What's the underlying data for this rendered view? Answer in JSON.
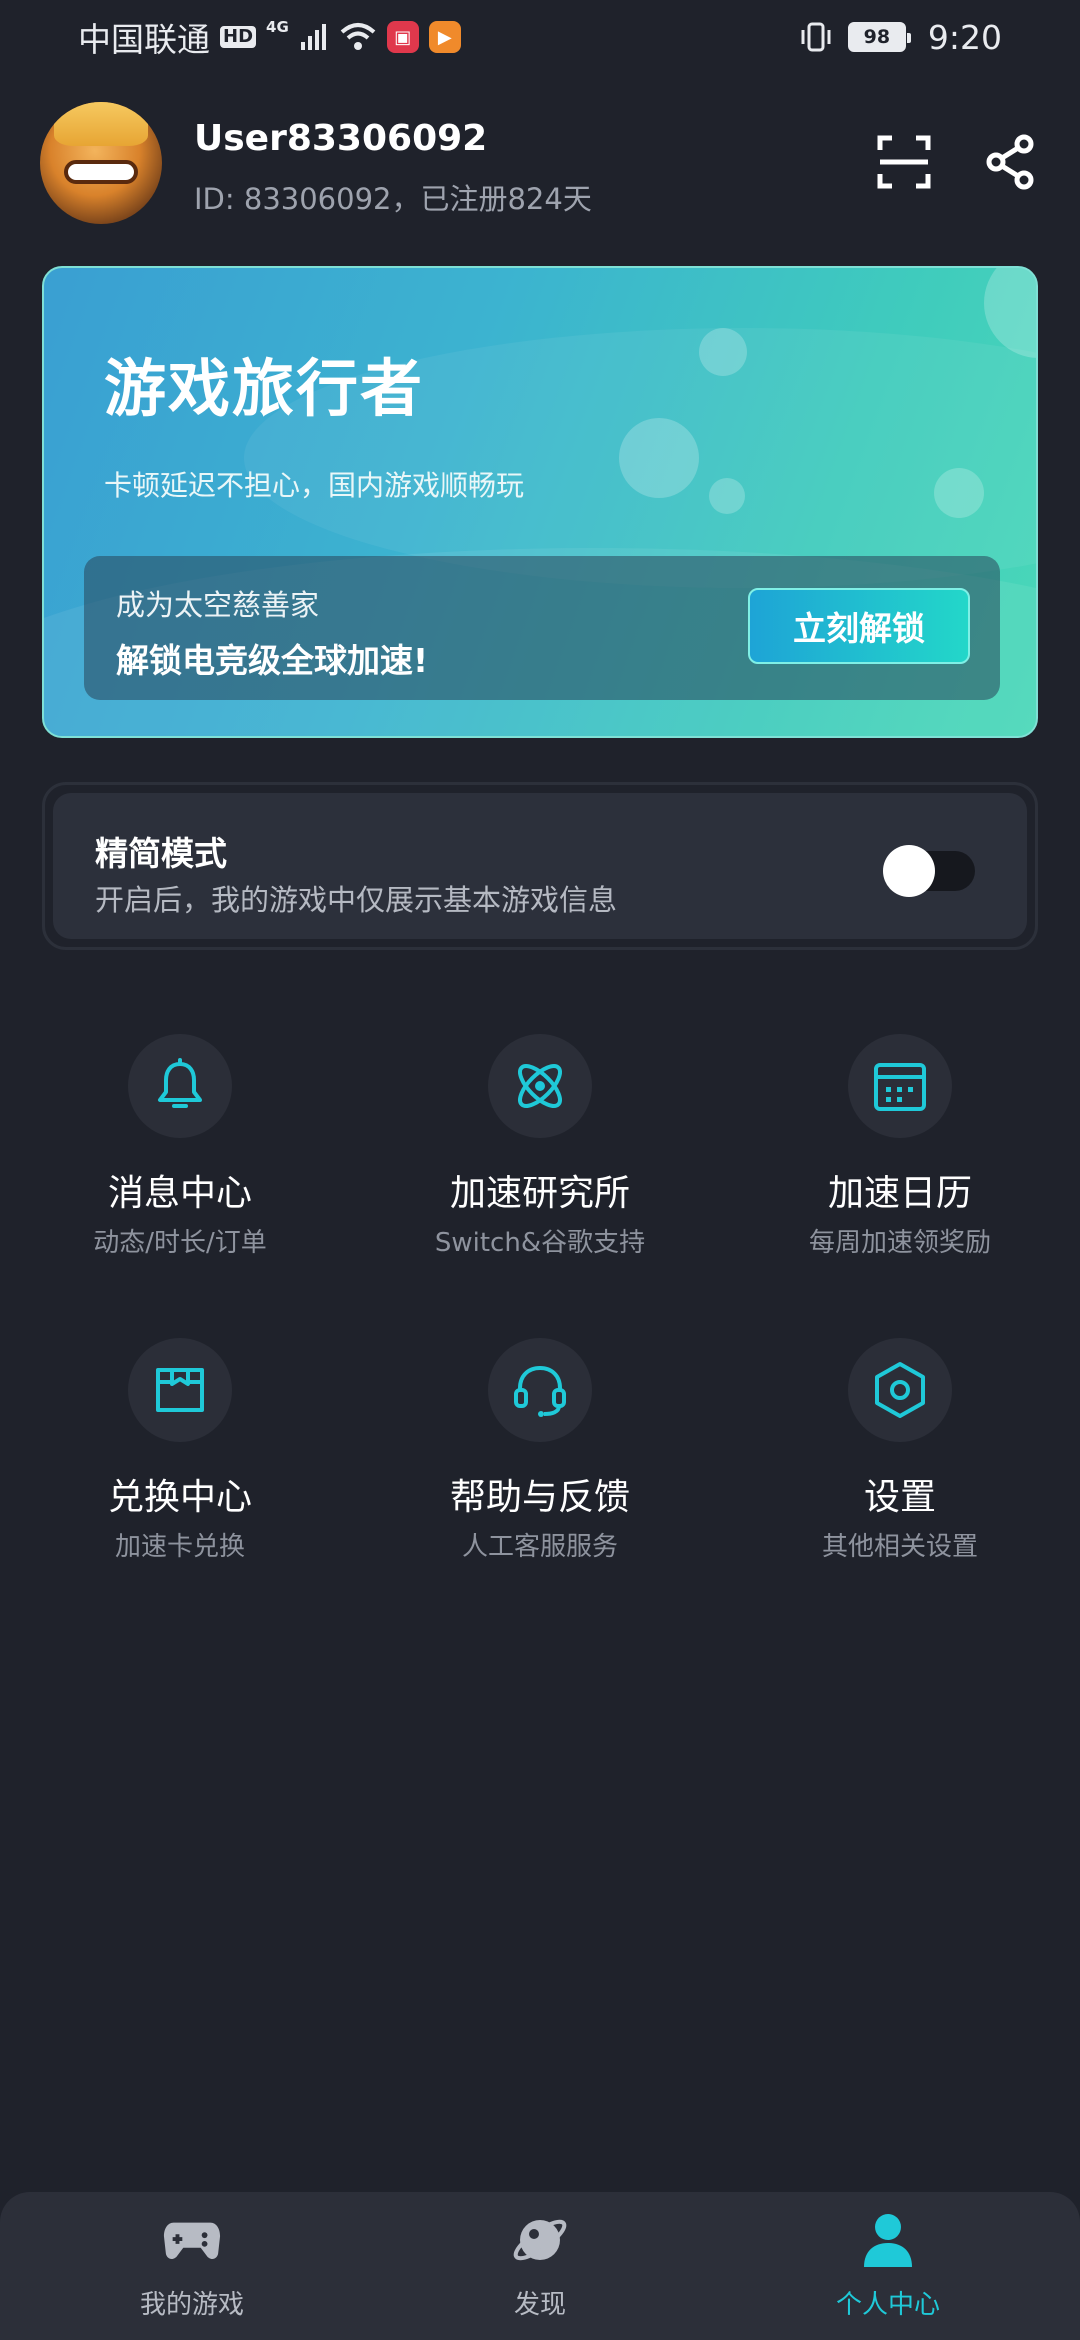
{
  "status_bar": {
    "carrier": "中国联通",
    "hd": "HD",
    "network": "4G",
    "battery": "98",
    "time": "9:20"
  },
  "header": {
    "username": "User83306092",
    "user_meta": "ID: 83306092，已注册824天",
    "scan_icon": "scan-icon",
    "share_icon": "share-icon"
  },
  "promo": {
    "title": "游戏旅行者",
    "subtitle": "卡顿延迟不担心，国内游戏顺畅玩",
    "line1": "成为太空慈善家",
    "line2": "解锁电竞级全球加速!",
    "button": "立刻解锁"
  },
  "simple_mode": {
    "title": "精简模式",
    "description": "开启后，我的游戏中仅展示基本游戏信息",
    "enabled": false
  },
  "menu": [
    {
      "icon": "bell-icon",
      "title": "消息中心",
      "subtitle": "动态/时长/订单"
    },
    {
      "icon": "atom-icon",
      "title": "加速研究所",
      "subtitle": "Switch&谷歌支持"
    },
    {
      "icon": "calendar-icon",
      "title": "加速日历",
      "subtitle": "每周加速领奖励"
    },
    {
      "icon": "gift-box-icon",
      "title": "兑换中心",
      "subtitle": "加速卡兑换"
    },
    {
      "icon": "headset-icon",
      "title": "帮助与反馈",
      "subtitle": "人工客服服务"
    },
    {
      "icon": "hexagon-nut-icon",
      "title": "设置",
      "subtitle": "其他相关设置"
    }
  ],
  "bottom_nav": [
    {
      "icon": "gamepad-icon",
      "label": "我的游戏",
      "active": false
    },
    {
      "icon": "planet-icon",
      "label": "发现",
      "active": false
    },
    {
      "icon": "person-icon",
      "label": "个人中心",
      "active": true
    }
  ],
  "colors": {
    "background": "#1f222b",
    "accent": "#1fc9d8",
    "card": "#2c303b"
  }
}
